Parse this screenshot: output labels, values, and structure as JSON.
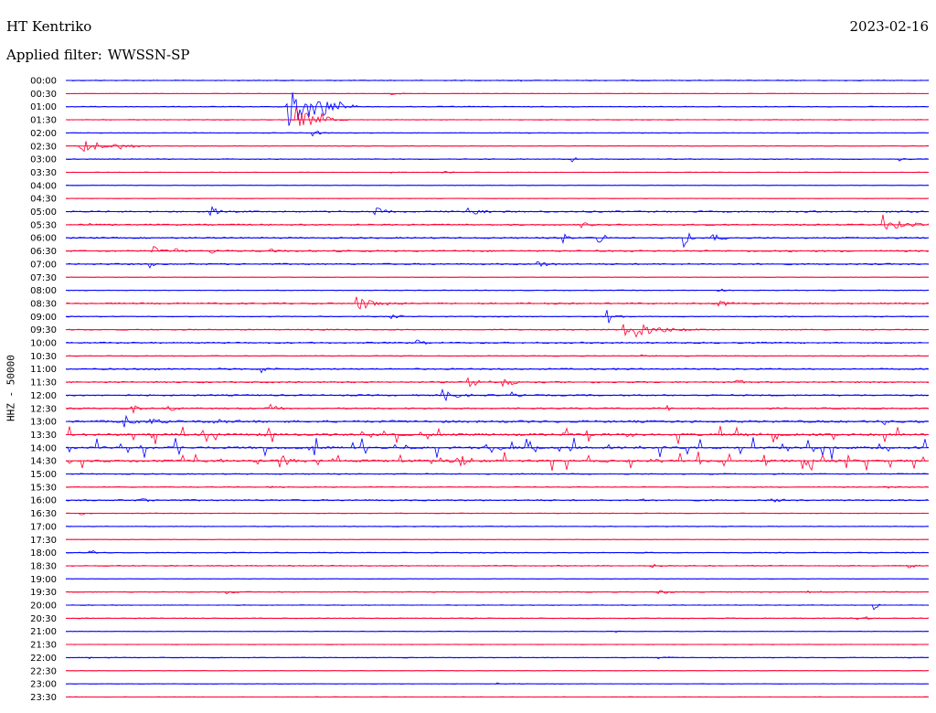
{
  "header": {
    "station": "HT Kentriko",
    "date": "2023-02-16",
    "filter_label": "Applied filter:",
    "filter_value": "WWSSN-SP"
  },
  "channel_label": "HHZ - 50000",
  "colors": {
    "even_trace": "#0000ff",
    "odd_trace": "#ff0033",
    "background": "#ffffff"
  },
  "traces": [
    {
      "time": "00:00",
      "noise": 0.5,
      "events": [
        [
          0.53,
          2,
          0.01
        ]
      ]
    },
    {
      "time": "00:30",
      "noise": 0.3,
      "events": [
        [
          0.38,
          2,
          0.02
        ]
      ]
    },
    {
      "time": "01:00",
      "noise": 0.5,
      "events": [
        [
          0.26,
          30,
          0.08
        ],
        [
          0.3,
          6,
          0.06
        ]
      ]
    },
    {
      "time": "01:30",
      "noise": 0.4,
      "events": [
        [
          0.27,
          20,
          0.04
        ],
        [
          0.3,
          6,
          0.03
        ]
      ]
    },
    {
      "time": "02:00",
      "noise": 0.4,
      "events": [
        [
          0.29,
          4,
          0.02
        ]
      ]
    },
    {
      "time": "02:30",
      "noise": 0.4,
      "events": [
        [
          0.02,
          10,
          0.06
        ],
        [
          0.06,
          5,
          0.04
        ]
      ]
    },
    {
      "time": "03:00",
      "noise": 0.5,
      "events": [
        [
          0.59,
          4,
          0.01
        ],
        [
          0.97,
          2,
          0.01
        ]
      ]
    },
    {
      "time": "03:30",
      "noise": 0.3,
      "events": [
        [
          0.38,
          2,
          0.01
        ],
        [
          0.44,
          2,
          0.02
        ]
      ]
    },
    {
      "time": "04:00",
      "noise": 0.3,
      "events": []
    },
    {
      "time": "04:30",
      "noise": 0.3,
      "events": []
    },
    {
      "time": "05:00",
      "noise": 0.8,
      "events": [
        [
          0.17,
          8,
          0.02
        ],
        [
          0.36,
          6,
          0.03
        ],
        [
          0.47,
          5,
          0.04
        ]
      ]
    },
    {
      "time": "05:30",
      "noise": 0.8,
      "events": [
        [
          0.95,
          12,
          0.05
        ],
        [
          0.6,
          3,
          0.03
        ],
        [
          0.03,
          2,
          0.02
        ]
      ]
    },
    {
      "time": "06:00",
      "noise": 0.8,
      "events": [
        [
          0.62,
          14,
          0.01
        ],
        [
          0.58,
          6,
          0.02
        ],
        [
          0.72,
          10,
          0.02
        ],
        [
          0.75,
          6,
          0.03
        ]
      ]
    },
    {
      "time": "06:30",
      "noise": 0.8,
      "events": [
        [
          0.1,
          10,
          0.02
        ],
        [
          0.13,
          4,
          0.02
        ],
        [
          0.17,
          4,
          0.02
        ],
        [
          0.24,
          3,
          0.02
        ]
      ]
    },
    {
      "time": "07:00",
      "noise": 0.8,
      "events": [
        [
          0.1,
          8,
          0.01
        ],
        [
          0.55,
          4,
          0.03
        ]
      ]
    },
    {
      "time": "07:30",
      "noise": 0.3,
      "events": []
    },
    {
      "time": "08:00",
      "noise": 0.4,
      "events": [
        [
          0.76,
          2,
          0.02
        ]
      ]
    },
    {
      "time": "08:30",
      "noise": 0.8,
      "events": [
        [
          0.34,
          10,
          0.05
        ],
        [
          0.76,
          4,
          0.03
        ]
      ]
    },
    {
      "time": "09:00",
      "noise": 0.5,
      "events": [
        [
          0.63,
          14,
          0.02
        ],
        [
          0.38,
          3,
          0.03
        ]
      ]
    },
    {
      "time": "09:30",
      "noise": 0.6,
      "events": [
        [
          0.65,
          14,
          0.09
        ],
        [
          0.3,
          2,
          0.01
        ]
      ]
    },
    {
      "time": "10:00",
      "noise": 0.8,
      "events": [
        [
          0.41,
          3,
          0.03
        ]
      ]
    },
    {
      "time": "10:30",
      "noise": 0.5,
      "events": [
        [
          0.67,
          3,
          0.02
        ]
      ]
    },
    {
      "time": "11:00",
      "noise": 0.8,
      "events": [
        [
          0.1,
          4,
          0.02
        ],
        [
          0.18,
          4,
          0.01
        ],
        [
          0.23,
          6,
          0.02
        ],
        [
          0.64,
          2,
          0.01
        ]
      ]
    },
    {
      "time": "11:30",
      "noise": 0.8,
      "events": [
        [
          0.47,
          8,
          0.03
        ],
        [
          0.51,
          6,
          0.03
        ],
        [
          0.78,
          5,
          0.02
        ]
      ]
    },
    {
      "time": "12:00",
      "noise": 0.8,
      "events": [
        [
          0.44,
          8,
          0.04
        ],
        [
          0.52,
          4,
          0.02
        ]
      ]
    },
    {
      "time": "12:30",
      "noise": 0.8,
      "events": [
        [
          0.08,
          6,
          0.02
        ],
        [
          0.12,
          5,
          0.02
        ],
        [
          0.24,
          6,
          0.02
        ],
        [
          0.7,
          4,
          0.02
        ]
      ]
    },
    {
      "time": "13:00",
      "noise": 1.2,
      "events": [
        [
          0.07,
          12,
          0.02
        ],
        [
          0.1,
          5,
          0.03
        ],
        [
          0.17,
          4,
          0.04
        ],
        [
          0.95,
          5,
          0.02
        ]
      ]
    },
    {
      "time": "13:30",
      "noise": 1.2,
      "spikes": 45,
      "spike_amp": 10,
      "events": []
    },
    {
      "time": "14:00",
      "noise": 1.2,
      "spikes": 60,
      "spike_amp": 12,
      "events": []
    },
    {
      "time": "14:30",
      "noise": 1.2,
      "spikes": 45,
      "spike_amp": 10,
      "events": [
        [
          0.25,
          10,
          0.03
        ],
        [
          0.46,
          8,
          0.03
        ],
        [
          0.68,
          6,
          0.02
        ]
      ]
    },
    {
      "time": "15:00",
      "noise": 0.6,
      "events": []
    },
    {
      "time": "15:30",
      "noise": 0.5,
      "events": [
        [
          0.24,
          3,
          0.02
        ],
        [
          0.95,
          3,
          0.02
        ]
      ]
    },
    {
      "time": "16:00",
      "noise": 0.8,
      "events": [
        [
          0.09,
          3,
          0.02
        ],
        [
          0.67,
          4,
          0.03
        ],
        [
          0.82,
          3,
          0.02
        ]
      ]
    },
    {
      "time": "16:30",
      "noise": 0.4,
      "events": [
        [
          0.02,
          2,
          0.02
        ]
      ]
    },
    {
      "time": "17:00",
      "noise": 0.4,
      "events": []
    },
    {
      "time": "17:30",
      "noise": 0.3,
      "events": []
    },
    {
      "time": "18:00",
      "noise": 0.5,
      "events": [
        [
          0.03,
          8,
          0.01
        ],
        [
          0.67,
          3,
          0.01
        ],
        [
          0.98,
          2,
          0.01
        ]
      ]
    },
    {
      "time": "18:30",
      "noise": 0.6,
      "events": [
        [
          0.68,
          3,
          0.03
        ],
        [
          0.98,
          3,
          0.02
        ]
      ]
    },
    {
      "time": "19:00",
      "noise": 0.3,
      "events": []
    },
    {
      "time": "19:30",
      "noise": 0.5,
      "events": [
        [
          0.19,
          3,
          0.02
        ],
        [
          0.69,
          3,
          0.04
        ],
        [
          0.86,
          3,
          0.04
        ]
      ]
    },
    {
      "time": "20:00",
      "noise": 0.4,
      "events": [
        [
          0.94,
          8,
          0.01
        ]
      ]
    },
    {
      "time": "20:30",
      "noise": 0.5,
      "events": [
        [
          0.92,
          4,
          0.03
        ]
      ]
    },
    {
      "time": "21:00",
      "noise": 0.3,
      "events": [
        [
          0.64,
          2,
          0.01
        ]
      ]
    },
    {
      "time": "21:30",
      "noise": 0.3,
      "events": []
    },
    {
      "time": "22:00",
      "noise": 0.4,
      "events": [
        [
          0.03,
          2,
          0.01
        ],
        [
          0.69,
          2,
          0.02
        ]
      ]
    },
    {
      "time": "22:30",
      "noise": 0.3,
      "events": []
    },
    {
      "time": "23:00",
      "noise": 0.3,
      "events": [
        [
          0.5,
          2,
          0.03
        ]
      ]
    },
    {
      "time": "23:30",
      "noise": 0.3,
      "events": []
    }
  ]
}
